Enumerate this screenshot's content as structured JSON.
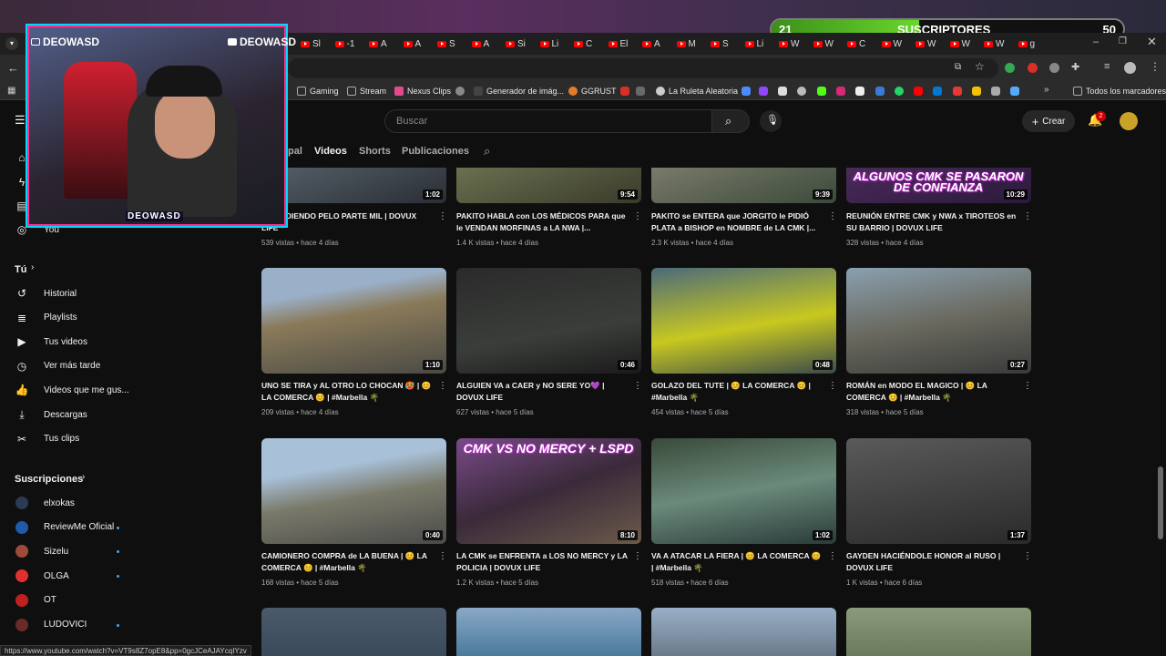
{
  "overlay": {
    "subs_current": "21",
    "subs_label": "SUSCRIPTORES",
    "subs_goal": "50",
    "subs_progress": 0.42,
    "cam_name_1": "DEOWASD",
    "cam_name_2": "DEOWASD",
    "cam_logo": "DEOWASD"
  },
  "browser": {
    "tabs": [
      "Sl",
      "-1",
      "A",
      "A",
      "S",
      "A",
      "Si",
      "Li",
      "C",
      "El",
      "A",
      "M",
      "S",
      "Li",
      "W",
      "W",
      "C",
      "W",
      "W",
      "W",
      "W",
      "g"
    ],
    "bookmarks": [
      "Gaming",
      "Stream",
      "Nexus Clips",
      "Generador de imág...",
      "GGRUST",
      "La Ruleta Aleatoria",
      "Todos los marcadores"
    ],
    "status_url": "https://www.youtube.com/watch?v=VT9s8Z7opE8&pp=0gcJCeAJAYcqIYzv"
  },
  "masthead": {
    "search_placeholder": "Buscar",
    "create_label": "Crear",
    "notif_count": "2"
  },
  "channel_tabs": [
    "pal",
    "Videos",
    "Shorts",
    "Publicaciones"
  ],
  "sidebar": {
    "you_label": "You",
    "tu_label": "Tú",
    "library": [
      "Historial",
      "Playlists",
      "Tus videos",
      "Ver más tarde",
      "Videos que me gus...",
      "Descargas",
      "Tus clips"
    ],
    "subs_heading": "Suscripciones",
    "subscriptions": [
      "elxokas",
      "ReviewMe Oficial",
      "Sizelu",
      "OLGA",
      "OT",
      "LUDOVICI"
    ]
  },
  "videos": [
    {
      "title": "... PERDIENDO PELO PARTE MIL | DOVUX LIFE",
      "views": "539 vistas",
      "age": "hace 4 días",
      "duration": "1:02"
    },
    {
      "title": "PAKITO HABLA con LOS MÉDICOS PARA que le VENDAN MORFINAS a LA NWA |...",
      "views": "1.4 K vistas",
      "age": "hace 4 días",
      "duration": "9:54"
    },
    {
      "title": "PAKITO se ENTERA que JORGITO le PIDIÓ PLATA a BISHOP en NOMBRE de LA CMK |...",
      "views": "2.3 K vistas",
      "age": "hace 4 días",
      "duration": "9:39"
    },
    {
      "title": "REUNIÓN ENTRE CMK y NWA x TIROTEOS en SU BARRIO | DOVUX LIFE",
      "views": "328 vistas",
      "age": "hace 4 días",
      "duration": "10:29",
      "thumb_text": "ALGUNOS CMK SE PASARON DE CONFIANZA"
    },
    {
      "title": "UNO SE TIRA y AL OTRO LO CHOCAN 🥵 | 😊 LA COMERCA 😊 | #Marbella 🌴",
      "views": "209 vistas",
      "age": "hace 4 días",
      "duration": "1:10"
    },
    {
      "title": "ALGUIEN VA a CAER y NO SERE YO💜 | DOVUX LIFE",
      "views": "627 vistas",
      "age": "hace 5 días",
      "duration": "0:46"
    },
    {
      "title": "GOLAZO DEL TUTE | 😊 LA COMERCA 😊 | #Marbella 🌴",
      "views": "454 vistas",
      "age": "hace 5 días",
      "duration": "0:48"
    },
    {
      "title": "ROMÁN en MODO EL MAGICO | 😊 LA COMERCA 😊 | #Marbella 🌴",
      "views": "318 vistas",
      "age": "hace 5 días",
      "duration": "0:27"
    },
    {
      "title": "CAMIONERO COMPRA de LA BUENA | 😊 LA COMERCA 😊 | #Marbella 🌴",
      "views": "168 vistas",
      "age": "hace 5 días",
      "duration": "0:40"
    },
    {
      "title": "LA CMK se ENFRENTA a LOS NO MERCY y LA POLICIA | DOVUX LIFE",
      "views": "1.2 K vistas",
      "age": "hace 5 días",
      "duration": "8:10",
      "thumb_text": "CMK VS NO MERCY + LSPD"
    },
    {
      "title": "VA A ATACAR LA FIERA | 😊 LA COMERCA 😊 | #Marbella 🌴",
      "views": "518 vistas",
      "age": "hace 6 días",
      "duration": "1:02"
    },
    {
      "title": "GAYDEN HACIÉNDOLE HONOR al RUSO | DOVUX LIFE",
      "views": "1 K vistas",
      "age": "hace 6 días",
      "duration": "1:37"
    }
  ]
}
